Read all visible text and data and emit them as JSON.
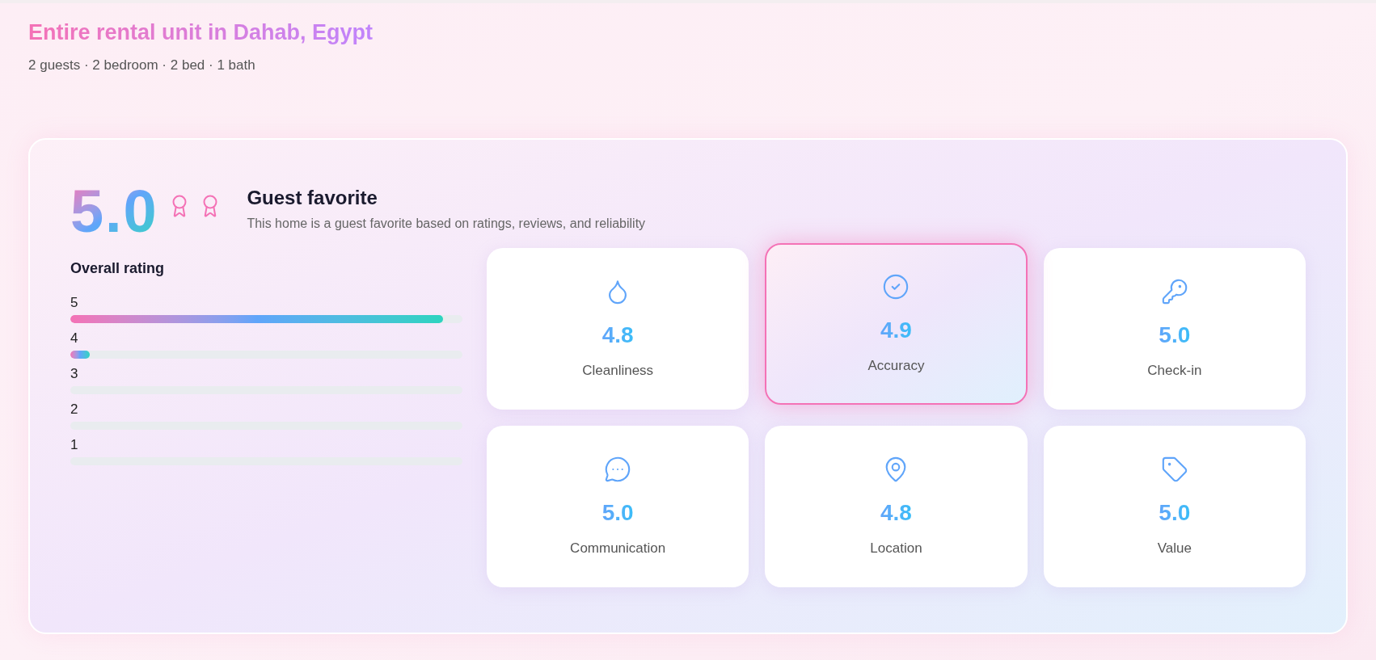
{
  "listing": {
    "title": "Entire rental unit in Dahab, Egypt",
    "details": "2 guests · 2 bedroom · 2 bed · 1 bath"
  },
  "summary": {
    "score": "5.0",
    "heading": "Guest favorite",
    "description": "This home is a guest favorite based on ratings, reviews, and reliability"
  },
  "overall": {
    "heading": "Overall rating",
    "bars": [
      {
        "label": "5",
        "level": 0.95
      },
      {
        "label": "4",
        "level": 0.05
      },
      {
        "label": "3",
        "level": 0
      },
      {
        "label": "2",
        "level": 0
      },
      {
        "label": "1",
        "level": 0
      }
    ]
  },
  "categories": [
    {
      "kind": "droplet",
      "score": "4.8",
      "label": "Cleanliness",
      "selected": false
    },
    {
      "kind": "check",
      "score": "4.9",
      "label": "Accuracy",
      "selected": true
    },
    {
      "kind": "key",
      "score": "5.0",
      "label": "Check-in",
      "selected": false
    },
    {
      "kind": "chat",
      "score": "5.0",
      "label": "Communication",
      "selected": false
    },
    {
      "kind": "pin",
      "score": "4.8",
      "label": "Location",
      "selected": false
    },
    {
      "kind": "tag",
      "score": "5.0",
      "label": "Value",
      "selected": false
    }
  ]
}
